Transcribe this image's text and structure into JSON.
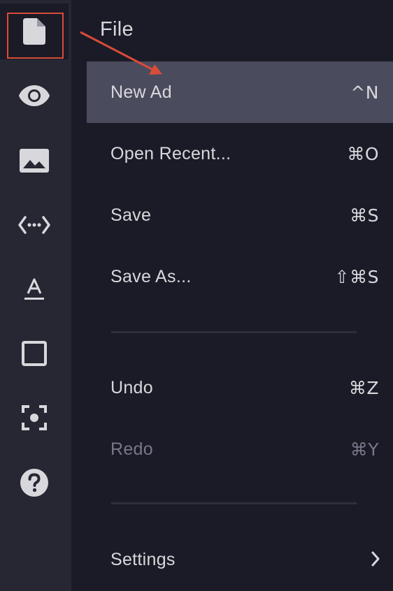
{
  "menu": {
    "title": "File",
    "items": [
      {
        "label": "New Ad",
        "shortcut": "^N"
      },
      {
        "label": "Open Recent...",
        "shortcut": "⌘O"
      },
      {
        "label": "Save",
        "shortcut": "⌘S"
      },
      {
        "label": "Save As...",
        "shortcut": "⇧⌘S"
      },
      {
        "label": "Undo",
        "shortcut": "⌘Z"
      },
      {
        "label": "Redo",
        "shortcut": "⌘Y"
      },
      {
        "label": "Settings",
        "shortcut": ""
      }
    ],
    "highlighted_item": "New Ad",
    "disabled_items": [
      "Redo"
    ]
  },
  "sidebar": {
    "icons": [
      "file-icon",
      "eye-icon",
      "image-icon",
      "code-icon",
      "text-icon",
      "square-icon",
      "focus-icon",
      "help-icon"
    ],
    "active": "file-icon"
  },
  "colors": {
    "background": "#1a1b26",
    "sidebar": "#262733",
    "highlight": "#4b4b5e",
    "annotation": "#d94b3a"
  }
}
